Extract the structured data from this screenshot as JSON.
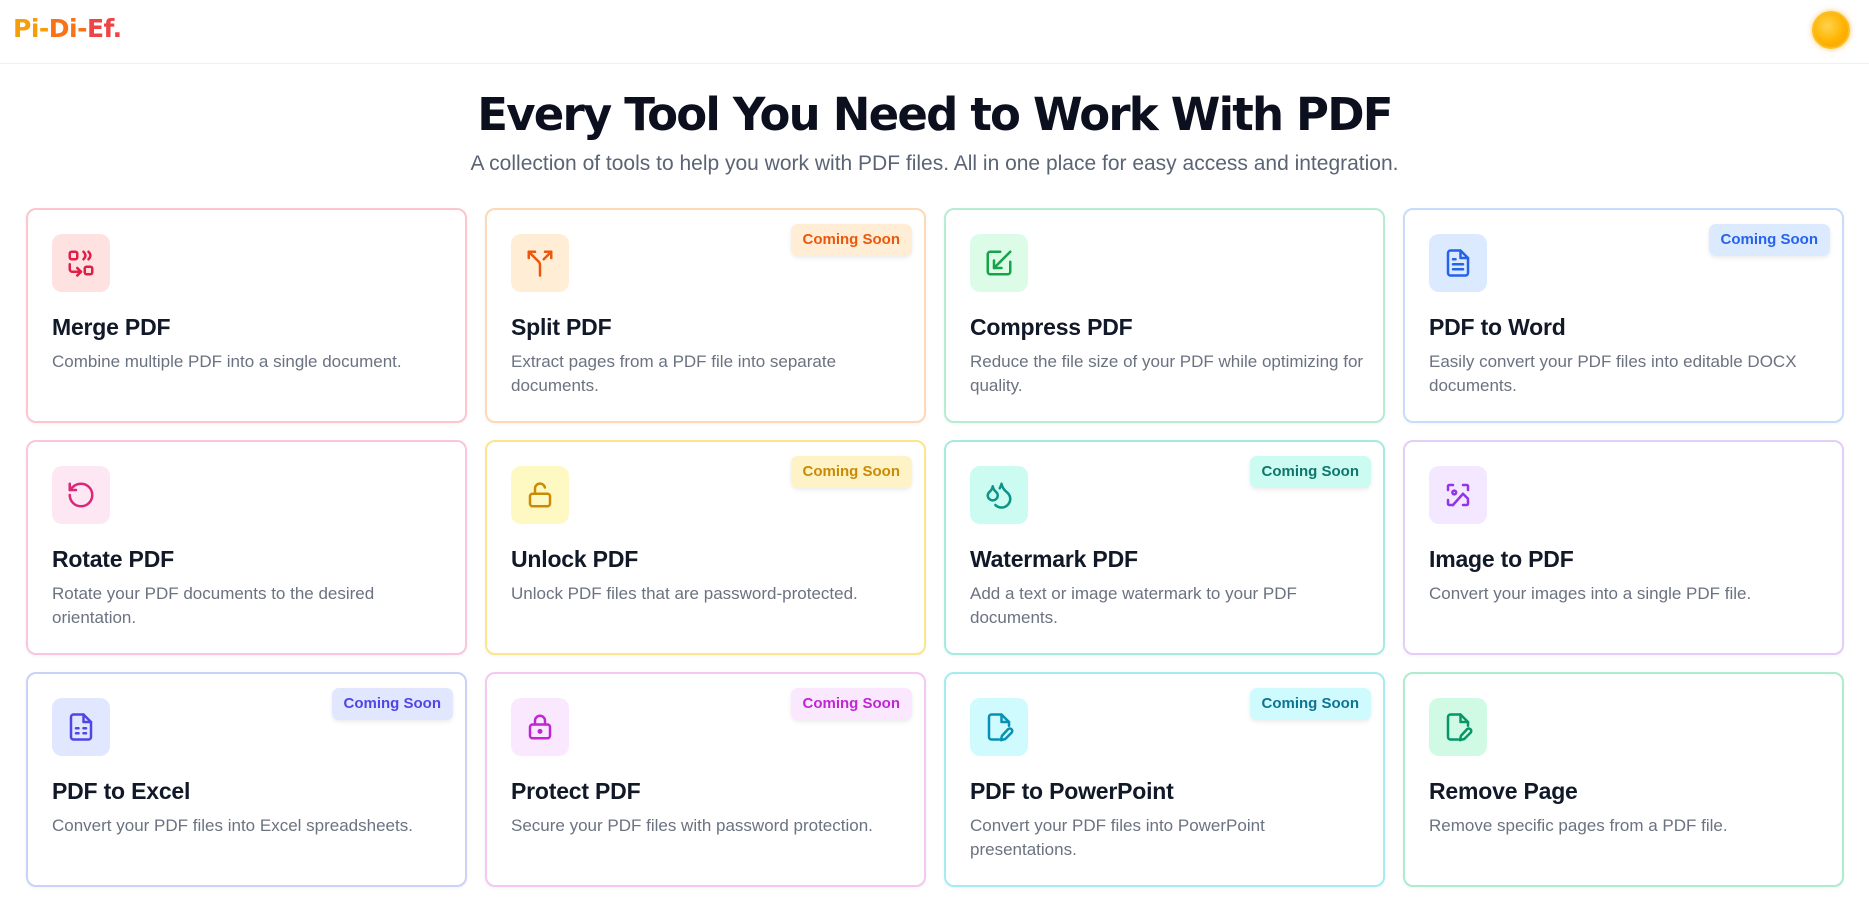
{
  "header": {
    "logo_part1": "Pi-",
    "logo_part2": "Di-",
    "logo_part3": "Ef.",
    "theme_toggle_icon": "sun-icon"
  },
  "hero": {
    "title": "Every Tool You Need to Work With PDF",
    "subtitle": "A collection of tools to help you work with PDF files. All in one place for easy access and integration."
  },
  "tools": [
    {
      "title": "Merge PDF",
      "description": "Combine multiple PDF into a single document.",
      "badge": "",
      "icon": "merge-icon",
      "accent": "#e11d48"
    },
    {
      "title": "Split PDF",
      "description": "Extract pages from a PDF file into separate documents.",
      "badge": "Coming Soon",
      "icon": "split-icon",
      "accent": "#ea580c"
    },
    {
      "title": "Compress PDF",
      "description": "Reduce the file size of your PDF while optimizing for quality.",
      "badge": "",
      "icon": "compress-icon",
      "accent": "#16a34a"
    },
    {
      "title": "PDF to Word",
      "description": "Easily convert your PDF files into editable DOCX documents.",
      "badge": "Coming Soon",
      "icon": "document-icon",
      "accent": "#2563eb"
    },
    {
      "title": "Rotate PDF",
      "description": "Rotate your PDF documents to the desired orientation.",
      "badge": "",
      "icon": "rotate-icon",
      "accent": "#db2777"
    },
    {
      "title": "Unlock PDF",
      "description": "Unlock PDF files that are password-protected.",
      "badge": "Coming Soon",
      "icon": "unlock-icon",
      "accent": "#ca8a04"
    },
    {
      "title": "Watermark PDF",
      "description": "Add a text or image watermark to your PDF documents.",
      "badge": "Coming Soon",
      "icon": "droplets-icon",
      "accent": "#0d9488"
    },
    {
      "title": "Image to PDF",
      "description": "Convert your images into a single PDF file.",
      "badge": "",
      "icon": "image-icon",
      "accent": "#9333ea"
    },
    {
      "title": "PDF to Excel",
      "description": "Convert your PDF files into Excel spreadsheets.",
      "badge": "Coming Soon",
      "icon": "spreadsheet-icon",
      "accent": "#4f46e5"
    },
    {
      "title": "Protect PDF",
      "description": "Secure your PDF files with password protection.",
      "badge": "Coming Soon",
      "icon": "lock-icon",
      "accent": "#c026d3"
    },
    {
      "title": "PDF to PowerPoint",
      "description": "Convert your PDF files into PowerPoint presentations.",
      "badge": "Coming Soon",
      "icon": "file-pen-icon",
      "accent": "#0891b2"
    },
    {
      "title": "Remove Page",
      "description": "Remove specific pages from a PDF file.",
      "badge": "",
      "icon": "file-pen-icon",
      "accent": "#059669"
    }
  ]
}
